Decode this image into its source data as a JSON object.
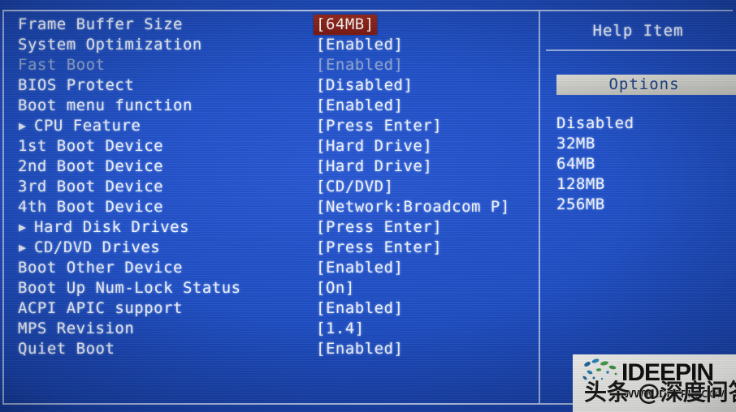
{
  "screen": {
    "background_color": "#2050c6",
    "text_color": "#f2f5ff",
    "dim_color": "#8ea5d2",
    "highlight_bg": "#8e2018",
    "options_bar_bg": "#d6d6d1",
    "options_bar_text_color": "#1c3f86"
  },
  "settings": {
    "rows": [
      {
        "label": "Frame Buffer Size",
        "value": "[64MB]",
        "selected": true,
        "dim": false,
        "sub": false
      },
      {
        "label": "System Optimization",
        "value": "[Enabled]",
        "selected": false,
        "dim": false,
        "sub": false
      },
      {
        "label": "Fast Boot",
        "value": "[Enabled]",
        "selected": false,
        "dim": true,
        "sub": false
      },
      {
        "label": "BIOS Protect",
        "value": "[Disabled]",
        "selected": false,
        "dim": false,
        "sub": false
      },
      {
        "label": "Boot menu function",
        "value": "[Enabled]",
        "selected": false,
        "dim": false,
        "sub": false
      },
      {
        "label": "CPU Feature",
        "value": "[Press Enter]",
        "selected": false,
        "dim": false,
        "sub": true
      },
      {
        "label": "1st Boot Device",
        "value": "[Hard Drive]",
        "selected": false,
        "dim": false,
        "sub": false
      },
      {
        "label": "2nd Boot Device",
        "value": "[Hard Drive]",
        "selected": false,
        "dim": false,
        "sub": false
      },
      {
        "label": "3rd Boot Device",
        "value": "[CD/DVD]",
        "selected": false,
        "dim": false,
        "sub": false
      },
      {
        "label": "4th Boot Device",
        "value": "[Network:Broadcom P]",
        "selected": false,
        "dim": false,
        "sub": false
      },
      {
        "label": "Hard Disk Drives",
        "value": "[Press Enter]",
        "selected": false,
        "dim": false,
        "sub": true
      },
      {
        "label": "CD/DVD Drives",
        "value": "[Press Enter]",
        "selected": false,
        "dim": false,
        "sub": true
      },
      {
        "label": "Boot Other Device",
        "value": "[Enabled]",
        "selected": false,
        "dim": false,
        "sub": false
      },
      {
        "label": "Boot Up Num-Lock Status",
        "value": "[On]",
        "selected": false,
        "dim": false,
        "sub": false
      },
      {
        "label": "ACPI APIC support",
        "value": "[Enabled]",
        "selected": false,
        "dim": false,
        "sub": false
      },
      {
        "label": "MPS Revision",
        "value": "[1.4]",
        "selected": false,
        "dim": false,
        "sub": false
      },
      {
        "label": "Quiet Boot",
        "value": "[Enabled]",
        "selected": false,
        "dim": false,
        "sub": false
      }
    ],
    "submenu_arrow_glyph": "▶"
  },
  "help": {
    "title": "Help Item",
    "options_header": "Options",
    "options": [
      "Disabled",
      "32MB",
      "64MB",
      "128MB",
      "256MB"
    ]
  },
  "watermark": {
    "brand": "IDEEPIN",
    "url": "WWW.IDEEPIN.COM",
    "chinese": "头条 @深度问答"
  }
}
